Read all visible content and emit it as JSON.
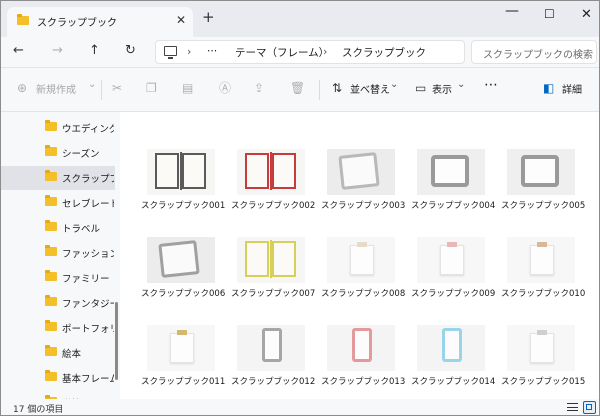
{
  "window": {
    "tab_title": "スクラップブック",
    "controls": {
      "minimize": "—",
      "maximize": "☐",
      "close": "✕",
      "new_tab": "+",
      "tab_close": "✕"
    }
  },
  "nav": {
    "back": "←",
    "forward": "→",
    "up": "↑",
    "refresh": "↻",
    "more": "⋯",
    "breadcrumb": [
      "テーマ（フレーム）",
      "スクラップブック"
    ],
    "search_placeholder": "スクラップブックの検索"
  },
  "toolbar": {
    "new_label": "新規作成",
    "sort_label": "並べ替え",
    "view_label": "表示",
    "more_label": "⋯",
    "details_label": "詳細",
    "icons": [
      "cut-icon",
      "copy-icon",
      "paste-icon",
      "rename-icon",
      "share-icon",
      "delete-icon"
    ]
  },
  "sidebar": {
    "items": [
      {
        "label": "ウエディング_I"
      },
      {
        "label": "シーズン"
      },
      {
        "label": "スクラップブック"
      },
      {
        "label": "セレブレート"
      },
      {
        "label": "トラベル"
      },
      {
        "label": "ファッション"
      },
      {
        "label": "ファミリー"
      },
      {
        "label": "ファンタジー"
      },
      {
        "label": "ポートフォリオ"
      },
      {
        "label": "絵本"
      },
      {
        "label": "基本フレーム"
      },
      {
        "label": "学校"
      }
    ],
    "selected_index": 2
  },
  "files": [
    {
      "name": "スクラップブック001",
      "style": "book",
      "color": "#5a5a5a"
    },
    {
      "name": "スクラップブック002",
      "style": "book",
      "color": "#c63b3b"
    },
    {
      "name": "スクラップブック003",
      "style": "tablet",
      "color": "#b8b8b8"
    },
    {
      "name": "スクラップブック004",
      "style": "device",
      "color": "#9a9a9a"
    },
    {
      "name": "スクラップブック005",
      "style": "device",
      "color": "#9a9a9a"
    },
    {
      "name": "スクラップブック006",
      "style": "tablet",
      "color": "#a0a0a0"
    },
    {
      "name": "スクラップブック007",
      "style": "book",
      "color": "#d6cf5a"
    },
    {
      "name": "スクラップブック008",
      "style": "note",
      "color": "#e6dcc8"
    },
    {
      "name": "スクラップブック009",
      "style": "note",
      "color": "#e8b8b8"
    },
    {
      "name": "スクラップブック010",
      "style": "note",
      "color": "#d9b89a"
    },
    {
      "name": "スクラップブック011",
      "style": "note",
      "color": "#d4b870"
    },
    {
      "name": "スクラップブック012",
      "style": "phone",
      "color": "#a6a6a6"
    },
    {
      "name": "スクラップブック013",
      "style": "phone",
      "color": "#e49a9a"
    },
    {
      "name": "スクラップブック014",
      "style": "phone",
      "color": "#9ad4e8"
    },
    {
      "name": "スクラップブック015",
      "style": "note",
      "color": "#cfcfcf"
    }
  ],
  "status": {
    "item_count": "17 個の項目"
  }
}
